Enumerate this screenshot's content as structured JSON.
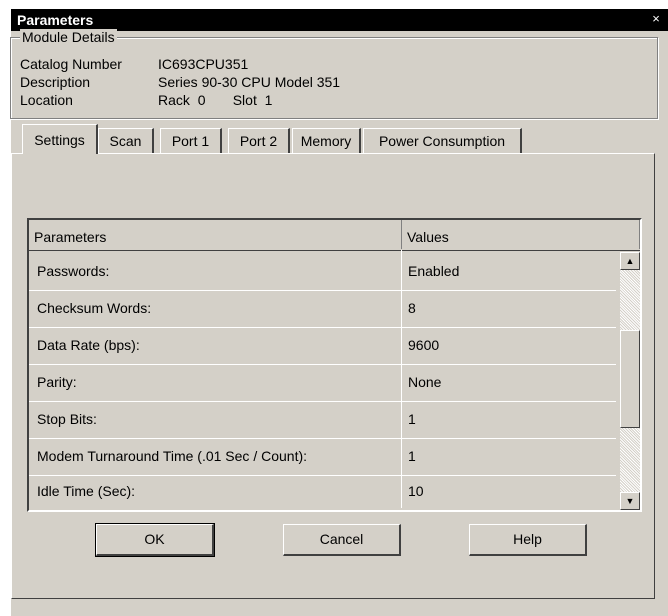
{
  "window": {
    "title": "Parameters",
    "close_glyph": "×"
  },
  "module_details": {
    "title": "Module Details",
    "catalog_number": {
      "label": "Catalog Number",
      "value": "IC693CPU351"
    },
    "description": {
      "label": "Description",
      "value": "Series 90-30 CPU Model 351"
    },
    "location": {
      "label": "Location",
      "rack_label": "Rack",
      "rack_value": "0",
      "slot_label": "Slot",
      "slot_value": "1"
    }
  },
  "tabs": [
    {
      "label": "Settings",
      "active": true
    },
    {
      "label": "Scan"
    },
    {
      "label": "Port 1"
    },
    {
      "label": "Port 2"
    },
    {
      "label": "Memory"
    },
    {
      "label": "Power Consumption"
    }
  ],
  "grid": {
    "headers": [
      "Parameters",
      "Values"
    ],
    "rows": [
      {
        "param": "Passwords:",
        "value": "Enabled"
      },
      {
        "param": "Checksum Words:",
        "value": "8"
      },
      {
        "param": "Data Rate (bps):",
        "value": "9600"
      },
      {
        "param": "Parity:",
        "value": "None"
      },
      {
        "param": "Stop Bits:",
        "value": "1"
      },
      {
        "param": "Modem Turnaround Time (.01 Sec / Count):",
        "value": "1"
      },
      {
        "param": "Idle Time (Sec):",
        "value": "10"
      }
    ]
  },
  "buttons": {
    "ok": "OK",
    "cancel": "Cancel",
    "help": "Help"
  }
}
